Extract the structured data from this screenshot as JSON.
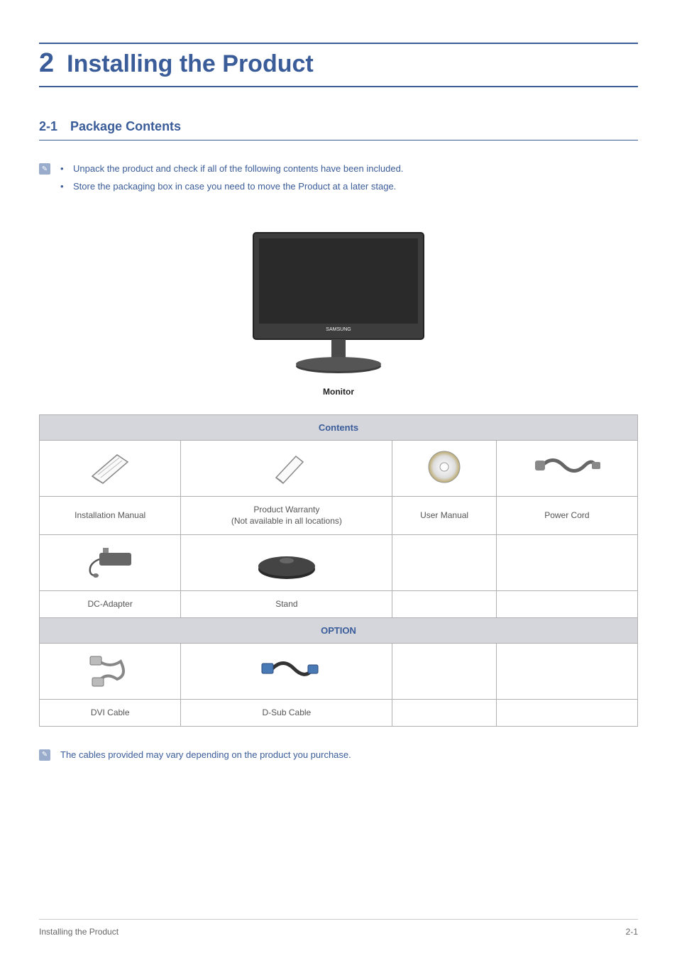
{
  "chapter": {
    "number": "2",
    "title": "Installing the Product"
  },
  "section": {
    "number": "2-1",
    "title": "Package Contents"
  },
  "notes": {
    "line1": "Unpack the product and check if all of the following contents have been included.",
    "line2": "Store the packaging box in case you need to move the Product at a later stage."
  },
  "monitor_label": "Monitor",
  "table": {
    "contents_header": "Contents",
    "option_header": "OPTION",
    "items": {
      "installation_manual": "Installation Manual",
      "product_warranty_line1": "Product Warranty",
      "product_warranty_line2": "(Not available in all locations)",
      "user_manual": "User Manual",
      "power_cord": "Power Cord",
      "dc_adapter": "DC-Adapter",
      "stand": "Stand",
      "dvi_cable": "DVI Cable",
      "dsub_cable": "D-Sub Cable"
    }
  },
  "footnote": "The cables provided may vary depending on the product you purchase.",
  "footer": {
    "left": "Installing the Product",
    "right": "2-1"
  }
}
